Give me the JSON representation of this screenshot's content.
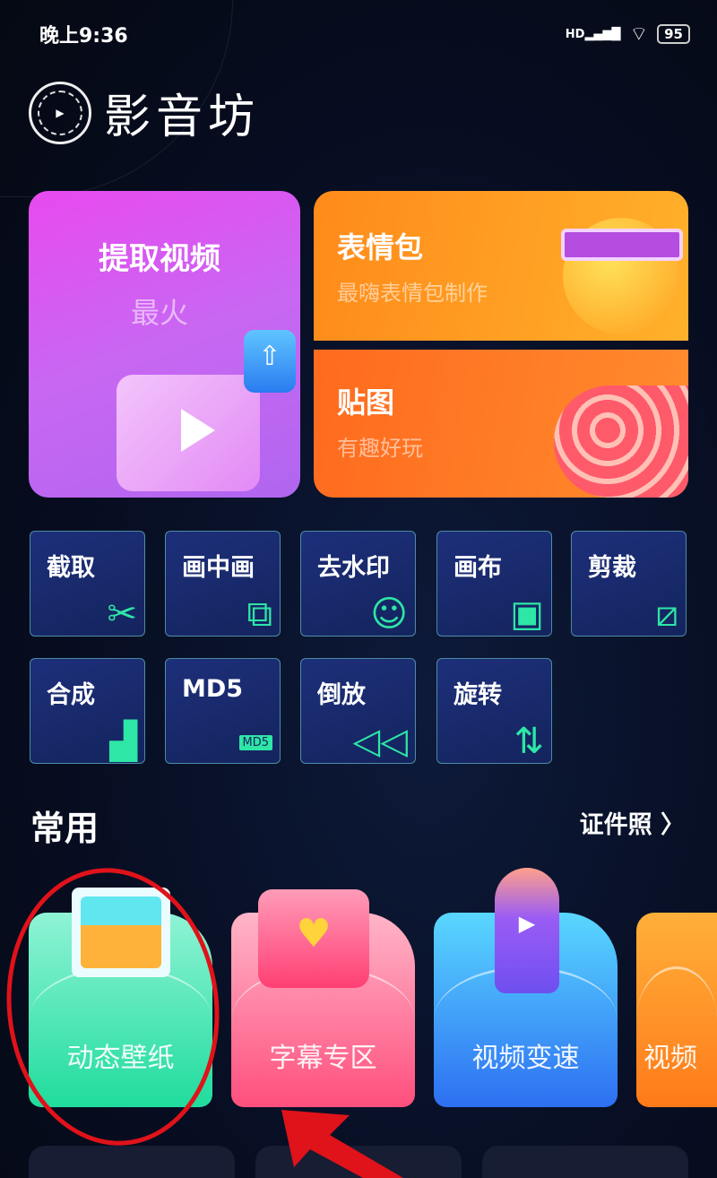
{
  "status_bar": {
    "time": "晚上9:36",
    "network": "HD",
    "battery": "95"
  },
  "app": {
    "title": "影音坊"
  },
  "banners": {
    "extract": {
      "title": "提取视频",
      "subtitle": "最火"
    },
    "emoji": {
      "title": "表情包",
      "subtitle": "最嗨表情包制作"
    },
    "sticker": {
      "title": "贴图",
      "subtitle": "有趣好玩"
    }
  },
  "tools": [
    {
      "label": "截取",
      "icon": "scissors-icon"
    },
    {
      "label": "画中画",
      "icon": "picture-in-picture-icon"
    },
    {
      "label": "去水印",
      "icon": "person-icon"
    },
    {
      "label": "画布",
      "icon": "canvas-icon"
    },
    {
      "label": "剪裁",
      "icon": "crop-icon"
    },
    {
      "label": "合成",
      "icon": "image-stack-icon"
    },
    {
      "label": "MD5",
      "icon": "md5-file-icon",
      "badge": "MD5"
    },
    {
      "label": "倒放",
      "icon": "rewind-icon"
    },
    {
      "label": "旋转",
      "icon": "rotate-icon"
    }
  ],
  "common": {
    "title": "常用",
    "more": "证件照",
    "cards": [
      {
        "label": "动态壁纸",
        "color": "#2de0a6"
      },
      {
        "label": "字幕专区",
        "color": "#ff4f7d"
      },
      {
        "label": "视频变速",
        "color": "#3a8af5"
      },
      {
        "label": "视频",
        "color": "#ff8a1a"
      }
    ]
  }
}
